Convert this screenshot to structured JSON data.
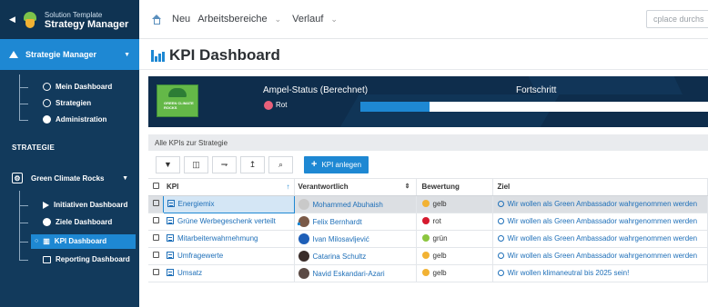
{
  "sidebar": {
    "app_subtitle": "Solution Template",
    "app_title": "Strategy Manager",
    "manager_label": "Strategie Manager",
    "manager_items": [
      {
        "label": "Mein Dashboard",
        "icon": "user-icon"
      },
      {
        "label": "Strategien",
        "icon": "settings-icon"
      },
      {
        "label": "Administration",
        "icon": "gears-icon"
      }
    ],
    "section_label": "STRATEGIE",
    "strategy_name": "Green Climate Rocks",
    "strategy_items": [
      {
        "label": "Initiativen Dashboard",
        "icon": "play-icon"
      },
      {
        "label": "Ziele Dashboard",
        "icon": "target-icon"
      },
      {
        "label": "KPI Dashboard",
        "icon": "chart-icon",
        "active": true
      },
      {
        "label": "Reporting Dashboard",
        "icon": "report-icon"
      }
    ]
  },
  "topbar": {
    "nav": [
      {
        "label": "Neu",
        "dropdown": false
      },
      {
        "label": "Arbeitsbereiche",
        "dropdown": true
      },
      {
        "label": "Verlauf",
        "dropdown": true
      }
    ],
    "search_placeholder": "cplace durchs"
  },
  "page": {
    "title": "KPI Dashboard"
  },
  "banner": {
    "ampel_label": "Ampel-Status (Berechnet)",
    "ampel_value": "Rot",
    "ampel_color": "#e8607a",
    "progress_label": "Fortschritt",
    "progress_value": 40,
    "progress_text": "40%",
    "image_text": "GREEN CLIMATE ROCKS"
  },
  "table": {
    "card_title": "Alle KPIs zur Strategie",
    "add_button": "KPI anlegen",
    "columns": {
      "kpi": "KPI",
      "verantwortlich": "Verantwortlich",
      "bewertung": "Bewertung",
      "ziel": "Ziel"
    },
    "rows": [
      {
        "kpi": "Energiemix",
        "person": "Mohammed Abuhaish",
        "avatar_color": "#c9c9c9",
        "rating": "gelb",
        "rating_color": "#f2b233",
        "ziel": "Wir wollen als Green Ambassador wahrgenommen werden",
        "selected": true
      },
      {
        "kpi": "Grüne Werbegeschenk verteilt",
        "person": "Felix Bernhardt",
        "avatar_color": "#7a5a48",
        "rating": "rot",
        "rating_color": "#d61a2e",
        "ziel": "Wir wollen als Green Ambassador wahrgenommen werden",
        "selected": false
      },
      {
        "kpi": "Mitarbeiterwahrnehmung",
        "person": "Ivan Milosavljević",
        "avatar_color": "#1e5fb8",
        "rating": "grün",
        "rating_color": "#8cc63f",
        "ziel": "Wir wollen als Green Ambassador wahrgenommen werden",
        "selected": false
      },
      {
        "kpi": "Umfragewerte",
        "person": "Catarina Schultz",
        "avatar_color": "#3a2d2a",
        "rating": "gelb",
        "rating_color": "#f2b233",
        "ziel": "Wir wollen als Green Ambassador wahrgenommen werden",
        "selected": false
      },
      {
        "kpi": "Umsatz",
        "person": "Navid Eskandari-Azari",
        "avatar_color": "#5b4a44",
        "rating": "gelb",
        "rating_color": "#f2b233",
        "ziel": "Wir wollen klimaneutral bis 2025 sein!",
        "selected": false
      }
    ]
  },
  "colors": {
    "sidebar_bg": "#123a5c",
    "accent": "#1e88d3",
    "banner_bg": "#0e2d4c"
  }
}
